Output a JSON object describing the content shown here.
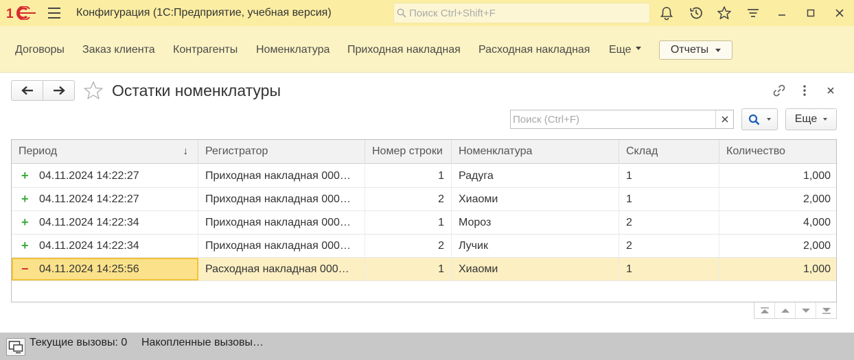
{
  "titlebar": {
    "app_title": "Конфигурация  (1С:Предприятие, учебная версия)",
    "search_placeholder": "Поиск Ctrl+Shift+F",
    "icons": [
      "bell-icon",
      "history-icon",
      "star-icon",
      "filter-icon",
      "minimize-icon",
      "maximize-icon",
      "close-icon"
    ]
  },
  "nav": {
    "items": [
      "Договоры",
      "Заказ клиента",
      "Контрагенты",
      "Номенклатура",
      "Приходная накладная",
      "Расходная накладная"
    ],
    "more_label": "Еще",
    "reports_label": "Отчеты"
  },
  "form": {
    "title": "Остатки номенклатуры",
    "search_placeholder": "Поиск (Ctrl+F)",
    "more_label": "Еще"
  },
  "table": {
    "columns": [
      "Период",
      "Регистратор",
      "Номер строки",
      "Номенклатура",
      "Склад",
      "Количество"
    ],
    "sort_indicator": "↓",
    "rows": [
      {
        "sign": "+",
        "period": "04.11.2024 14:22:27",
        "registrator": "Приходная накладная 000…",
        "line": "1",
        "item": "Радуга",
        "warehouse": "1",
        "qty": "1,000"
      },
      {
        "sign": "+",
        "period": "04.11.2024 14:22:27",
        "registrator": "Приходная накладная 000…",
        "line": "2",
        "item": "Хиаоми",
        "warehouse": "1",
        "qty": "2,000"
      },
      {
        "sign": "+",
        "period": "04.11.2024 14:22:34",
        "registrator": "Приходная накладная 000…",
        "line": "1",
        "item": "Мороз",
        "warehouse": "2",
        "qty": "4,000"
      },
      {
        "sign": "+",
        "period": "04.11.2024 14:22:34",
        "registrator": "Приходная накладная 000…",
        "line": "2",
        "item": "Лучик",
        "warehouse": "2",
        "qty": "2,000"
      },
      {
        "sign": "−",
        "period": "04.11.2024 14:25:56",
        "registrator": "Расходная накладная 000…",
        "line": "1",
        "item": "Хиаоми",
        "warehouse": "1",
        "qty": "1,000"
      }
    ]
  },
  "status": {
    "current_calls": "Текущие вызовы: 0",
    "accumulated_calls": "Накопленные вызовы…"
  },
  "colors": {
    "titlebar_bg": "#fbeda2",
    "navbar_bg": "#fbf3c3",
    "selected_row": "#fcefc2",
    "plus": "#3bab3a",
    "minus": "#d32f2f",
    "brand_red": "#d9272e"
  }
}
